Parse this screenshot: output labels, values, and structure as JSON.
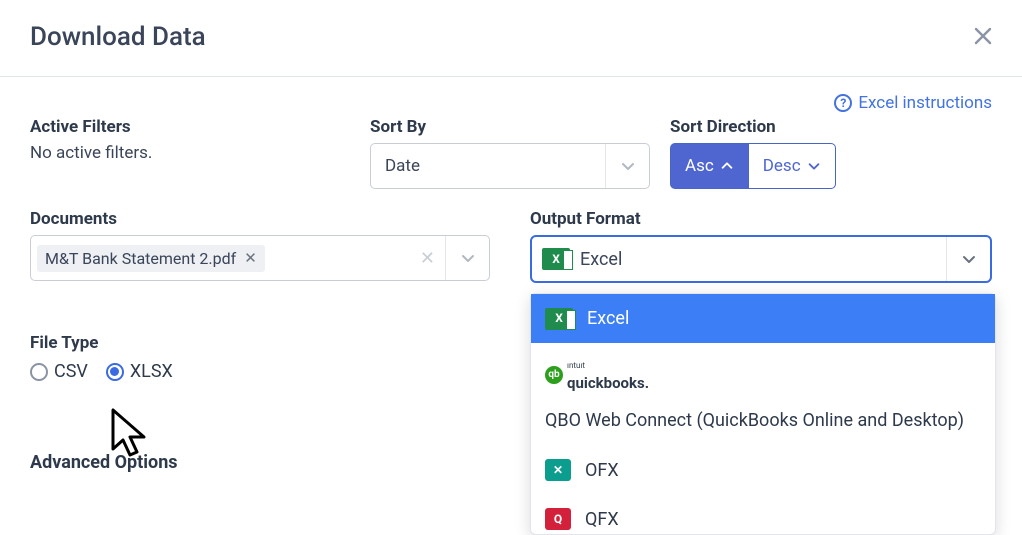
{
  "header": {
    "title": "Download Data"
  },
  "help": {
    "link_text": "Excel instructions"
  },
  "filters": {
    "active_label": "Active Filters",
    "active_text": "No active filters."
  },
  "sort_by": {
    "label": "Sort By",
    "value": "Date"
  },
  "sort_dir": {
    "label": "Sort Direction",
    "asc": "Asc",
    "desc": "Desc"
  },
  "documents": {
    "label": "Documents",
    "chip": "M&T Bank Statement 2.pdf"
  },
  "output": {
    "label": "Output Format",
    "value": "Excel",
    "options": {
      "excel": "Excel",
      "qbo": "QBO Web Connect (QuickBooks Online and Desktop)",
      "ofx": "OFX",
      "qfx": "QFX"
    }
  },
  "file_type": {
    "label": "File Type",
    "csv": "CSV",
    "xlsx": "XLSX"
  },
  "advanced": {
    "label": "Advanced Options"
  }
}
